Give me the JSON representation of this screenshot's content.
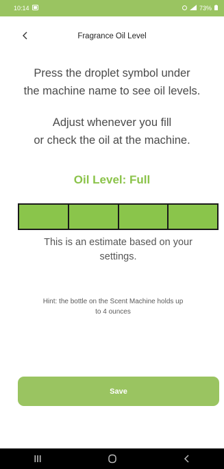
{
  "status_bar": {
    "time": "10:14",
    "battery": "73%",
    "background": "#9ac461"
  },
  "header": {
    "title": "Fragrance Oil Level",
    "back_icon": "chevron-left-icon"
  },
  "instructions": {
    "line1": "Press the droplet symbol under",
    "line2": "the machine name to see oil levels.",
    "line3": "Adjust whenever you fill",
    "line4": "or check the oil at the machine."
  },
  "oil_level": {
    "label": "Oil Level: Full",
    "color": "#8bc34a",
    "filled_segments": 4,
    "total_segments": 4
  },
  "estimate_note": {
    "line1": "This is an estimate based on your",
    "line2": "settings."
  },
  "hint": {
    "line1": "Hint: the bottle on the Scent Machine holds up",
    "line2": "to 4 ounces"
  },
  "save_button": {
    "label": "Save",
    "color": "#9ac461"
  },
  "nav_bar": {
    "icons": [
      "recent-apps-icon",
      "home-icon",
      "back-icon"
    ]
  }
}
